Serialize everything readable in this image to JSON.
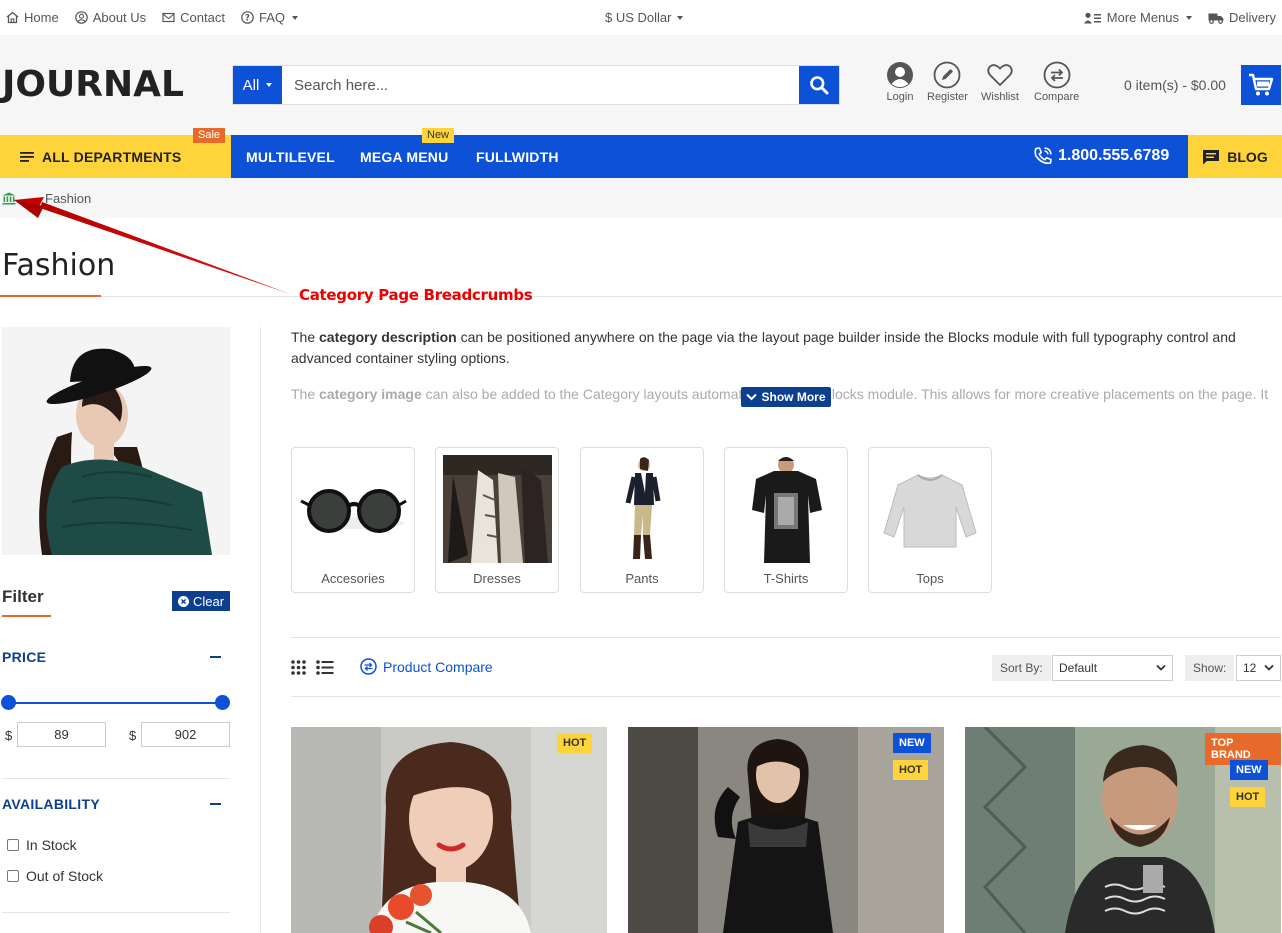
{
  "topbar": {
    "links": [
      {
        "label": "Home",
        "icon": "home-icon"
      },
      {
        "label": "About Us",
        "icon": "user-icon"
      },
      {
        "label": "Contact",
        "icon": "mail-icon"
      },
      {
        "label": "FAQ",
        "icon": "question-icon"
      }
    ],
    "currency": "$ US Dollar",
    "more_menus": "More Menus",
    "delivery": "Delivery"
  },
  "header": {
    "logo": "JOURNAL",
    "search_category": "All",
    "search_placeholder": "Search here...",
    "icons": [
      {
        "label": "Login",
        "icon": "user-circle-icon"
      },
      {
        "label": "Register",
        "icon": "pencil-icon"
      },
      {
        "label": "Wishlist",
        "icon": "heart-icon"
      },
      {
        "label": "Compare",
        "icon": "compare-icon"
      }
    ],
    "cart_summary": "0 item(s) - $0.00"
  },
  "nav": {
    "departments": "ALL DEPARTMENTS",
    "sale_badge": "Sale",
    "links": [
      "MULTILEVEL",
      "MEGA MENU",
      "FULLWIDTH"
    ],
    "new_badge": "New",
    "phone": "1.800.555.6789",
    "blog": "BLOG"
  },
  "breadcrumb": {
    "separator": "→",
    "current": "Fashion"
  },
  "page": {
    "title": "Fashion",
    "annotation": "Category Page Breadcrumbs"
  },
  "description": {
    "p1_a": "The ",
    "p1_b": "category description",
    "p1_c": " can be positioned anywhere on the page via the layout page builder inside the Blocks module with full typography control and advanced container styling options.",
    "p2_a": "The ",
    "p2_b": "category image",
    "p2_c": " can also be added to the Category layouts automatically via the Blocks module. This allows for more creative placements on the page. It",
    "show_more": "Show More"
  },
  "categories": [
    "Accesories",
    "Dresses",
    "Pants",
    "T-Shirts",
    "Tops"
  ],
  "filter": {
    "title": "Filter",
    "clear": "Clear",
    "price_title": "PRICE",
    "currency_symbol": "$",
    "price_min": "89",
    "price_max": "902",
    "availability_title": "AVAILABILITY",
    "options": [
      "In Stock",
      "Out of Stock"
    ]
  },
  "toolbar": {
    "compare": "Product Compare",
    "sort_label": "Sort By:",
    "sort_value": "Default",
    "show_label": "Show:",
    "show_value": "12"
  },
  "products": [
    {
      "tags": [
        "HOT"
      ]
    },
    {
      "tags": [
        "NEW",
        "HOT"
      ]
    },
    {
      "tags": [
        "TOP BRAND",
        "NEW",
        "HOT"
      ]
    }
  ],
  "colors": {
    "primary_blue": "#0d52d6",
    "dark_blue": "#0d3f8f",
    "yellow": "#ffd43b",
    "orange": "#e86a2b",
    "annotation_red": "#e00000"
  }
}
